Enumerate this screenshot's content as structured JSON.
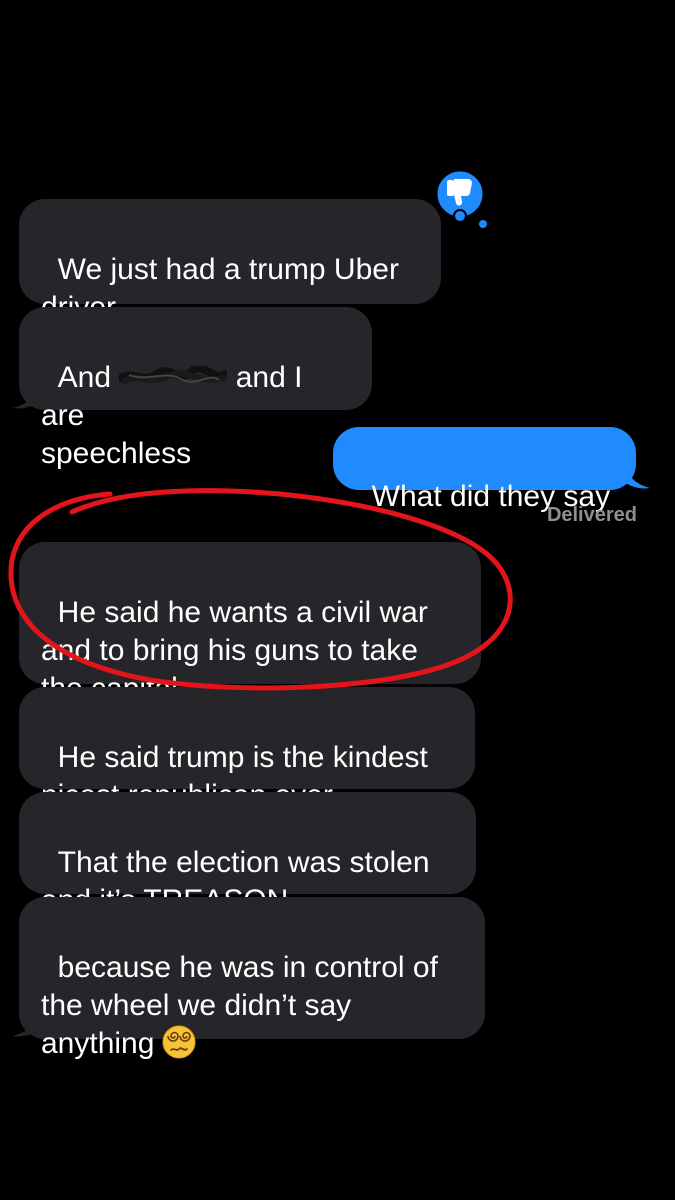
{
  "conversation": {
    "messages": [
      {
        "id": "m1",
        "sender": "other",
        "text": "We just had a trump Uber\ndriver"
      },
      {
        "id": "m2",
        "sender": "other",
        "text_before": "And ",
        "text_after": " and I are\nspeechless"
      },
      {
        "id": "m3",
        "sender": "me",
        "text": "What did they say"
      },
      {
        "id": "m4",
        "sender": "other",
        "text": "He said he wants a civil war\nand to bring his guns to take\nthe capital"
      },
      {
        "id": "m5",
        "sender": "other",
        "text": "He said trump is the kindest\nnicest republican ever"
      },
      {
        "id": "m6",
        "sender": "other",
        "text": "That the election was stolen\nand it’s TREASON"
      },
      {
        "id": "m7",
        "sender": "other",
        "text": "because he was in control of\nthe wheel we didn’t say\nanything",
        "emoji": "dizzy-face"
      }
    ],
    "status": "Delivered",
    "tapback": {
      "message_id": "m1",
      "icon": "thumbs-down-icon",
      "color": "#1f8bff"
    }
  },
  "colors": {
    "background": "#000000",
    "incoming_bubble": "#26252a",
    "outgoing_bubble": "#1f8bff",
    "highlight_circle": "#e3141b",
    "status_text": "#8e8e93"
  }
}
